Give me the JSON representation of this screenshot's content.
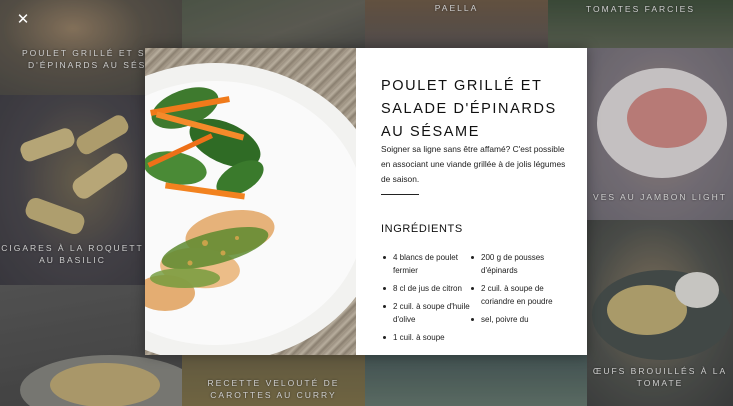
{
  "grid": {
    "tiles": [
      {
        "label_line1": "POULET GRILLÉ ET SAL",
        "label_line2": "D'ÉPINARDS AU SÉSA"
      },
      {
        "label_line1": "PAELLA"
      },
      {
        "label_line1": "TOMATES FARCIES"
      },
      {
        "label_line1": "CIGARES À LA ROQUETT",
        "label_line2": "AU BASILIC"
      },
      {
        "label_line1": "VES AU JAMBON LIGHT"
      },
      {
        "label_line1": "ŒUFS BROUILLÉS À LA",
        "label_line2": "TOMATE"
      },
      {
        "label_line1": "RECETTE VELOUTÉ DE",
        "label_line2": "CAROTTES AU CURRY"
      }
    ]
  },
  "modal": {
    "title": "POULET GRILLÉ ET SALADE D'ÉPINARDS AU SÉSAME",
    "intro": "Soigner sa ligne sans être affamé? C'est possible en associant une viande grillée à de jolis légumes de saison.",
    "ingredients_title": "INGRÉDIENTS",
    "ingredients_col1": [
      "4 blancs de poulet fermier",
      "8 cl de jus de citron",
      "2 cuil. à soupe d'huile d'olive",
      "1 cuil. à soupe"
    ],
    "ingredients_col2": [
      "200 g de pousses d'épinards",
      "2 cuil. à soupe de coriandre en poudre",
      "sel, poivre du"
    ]
  },
  "close": {
    "glyph": "✕"
  },
  "icons": {
    "close": "close-icon"
  },
  "colors": {
    "modal_bg": "#ffffff",
    "text": "#111111",
    "overlay_text": "#f4f4f4"
  }
}
